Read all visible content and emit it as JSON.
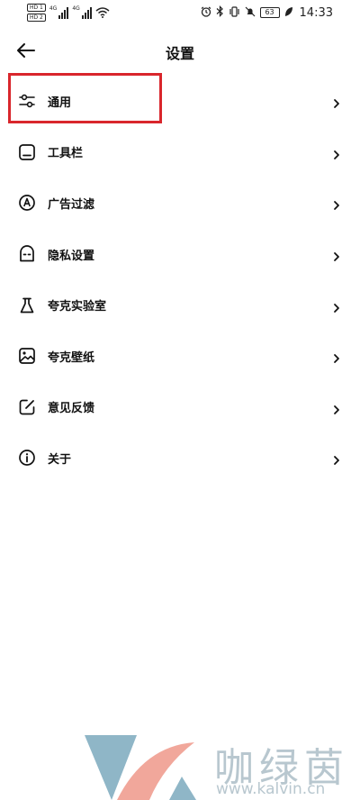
{
  "status_bar": {
    "sim1": "HD 1",
    "sim2": "HD 2",
    "net1": "4G",
    "net2": "4G",
    "battery": "63",
    "time": "14:33"
  },
  "header": {
    "title": "设置"
  },
  "menu": [
    {
      "label": "通用",
      "icon": "sliders-icon"
    },
    {
      "label": "工具栏",
      "icon": "toolbar-icon"
    },
    {
      "label": "广告过滤",
      "icon": "ad-filter-icon"
    },
    {
      "label": "隐私设置",
      "icon": "privacy-mask-icon"
    },
    {
      "label": "夸克实验室",
      "icon": "flask-icon"
    },
    {
      "label": "夸克壁纸",
      "icon": "wallpaper-icon"
    },
    {
      "label": "意见反馈",
      "icon": "feedback-edit-icon"
    },
    {
      "label": "关于",
      "icon": "info-icon"
    }
  ],
  "highlight": {
    "color": "#d9262c",
    "target": "通用"
  },
  "watermark": {
    "title": "咖绿茵",
    "url": "www.kalvin.cn"
  }
}
